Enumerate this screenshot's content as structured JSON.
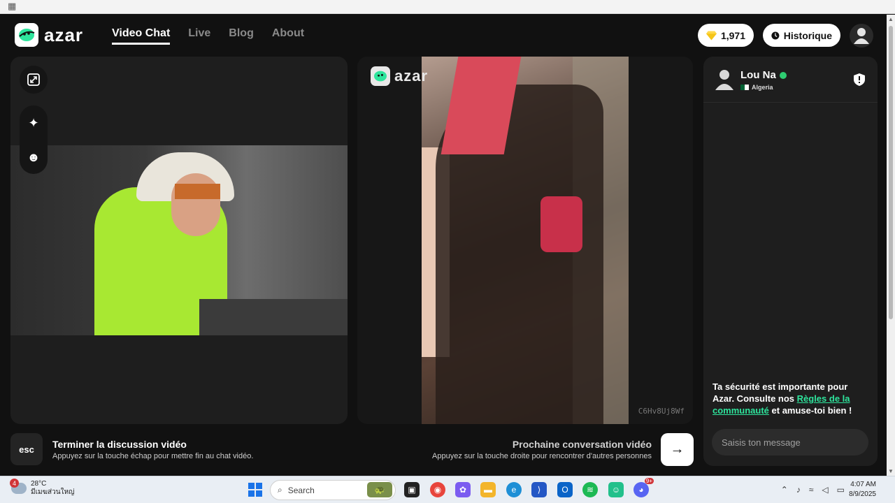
{
  "brand": {
    "name": "azar",
    "accent": "#2ee59d"
  },
  "nav": {
    "items": [
      {
        "label": "Video Chat",
        "active": true
      },
      {
        "label": "Live",
        "active": false
      },
      {
        "label": "Blog",
        "active": false
      },
      {
        "label": "About",
        "active": false
      }
    ]
  },
  "header": {
    "gems_count": "1,971",
    "history_label": "Historique"
  },
  "remote": {
    "watermark": "azar",
    "session_code": "C6Hv8Uj8Wf"
  },
  "peer": {
    "name": "Lou Na",
    "country": "Algeria"
  },
  "chat": {
    "safety_prefix": "Ta sécurité est importante pour Azar. Consulte nos ",
    "safety_link": "Règles de la communauté",
    "safety_suffix": " et amuse-toi bien !",
    "input_placeholder": "Saisis ton message"
  },
  "controls": {
    "esc_label": "esc",
    "end_title": "Terminer la discussion vidéo",
    "end_sub": "Appuyez sur la touche échap pour mettre fin au chat vidéo.",
    "next_title": "Prochaine conversation vidéo",
    "next_sub": "Appuyez sur la touche droite pour rencontrer d'autres personnes"
  },
  "taskbar": {
    "weather_temp": "28°C",
    "weather_desc": "มีเมฆส่วนใหญ่",
    "weather_badge": "4",
    "search_placeholder": "Search",
    "time": "4:07 AM",
    "date": "8/9/2025",
    "discord_badge": "9+"
  }
}
